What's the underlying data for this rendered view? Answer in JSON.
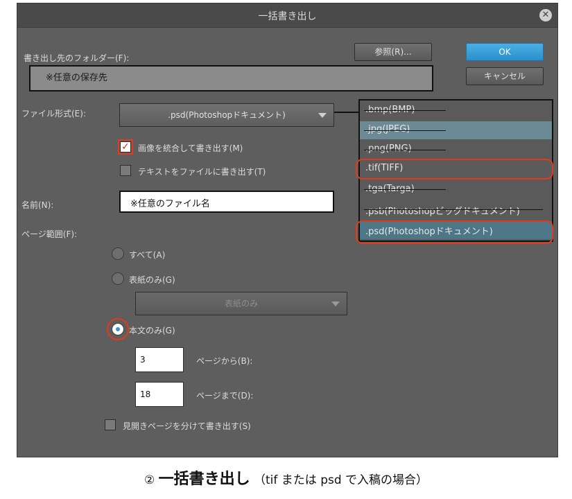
{
  "dialog": {
    "title": "一括書き出し",
    "close_glyph": "✕",
    "export_folder_label": "書き出し先のフォルダー(F):",
    "folder_value": "※任意の保存先",
    "browse_button": "参照(R)...",
    "ok_button": "OK",
    "cancel_button": "キャンセル",
    "file_format_label": "ファイル形式(E):",
    "file_format_value": ".psd(Photoshopドキュメント)",
    "merge_images_label": "画像を統合して書き出す(M)",
    "merge_images_checked": true,
    "export_text_label": "テキストをファイルに書き出す(T)",
    "export_text_checked": false,
    "name_label": "名前(N):",
    "name_value": "※任意のファイル名",
    "page_range_label": "ページ範囲(F):",
    "radio_all": "すべて(A)",
    "radio_cover": "表紙のみ(G)",
    "cover_select_value": "表紙のみ",
    "radio_body": "本文のみ(G)",
    "selected_range": "本文のみ(G)",
    "page_from_value": "3",
    "page_from_label": "ページから(B):",
    "page_to_value": "18",
    "page_to_label": "ページまで(D):",
    "spread_label": "見開きページを分けて書き出す(S)",
    "spread_checked": false
  },
  "format_options": [
    {
      "label": ".bmp(BMP)",
      "struck": true,
      "circled": false,
      "selected": false
    },
    {
      "label": ".jpg(JPEG)",
      "struck": true,
      "circled": false,
      "selected": false
    },
    {
      "label": ".png(PNG)",
      "struck": true,
      "circled": false,
      "selected": false
    },
    {
      "label": ".tif(TIFF)",
      "struck": false,
      "circled": true,
      "selected": false
    },
    {
      "label": ".tga(Targa)",
      "struck": true,
      "circled": false,
      "selected": false
    },
    {
      "label": ".psb(Photoshopビッグドキュメント)",
      "struck": true,
      "circled": false,
      "selected": false
    },
    {
      "label": ".psd(Photoshopドキュメント)",
      "struck": false,
      "circled": true,
      "selected": true
    }
  ],
  "caption": {
    "marker": "②",
    "title": "一括書き出し",
    "note": "（tif または psd で入稿の場合）"
  },
  "colors": {
    "dialog_bg": "#5e5e5e",
    "ok_blue": "#2b8fcb",
    "highlight_red": "#e23a1d",
    "hover_row": "#6b8a96",
    "selected_row": "#4d7686"
  }
}
